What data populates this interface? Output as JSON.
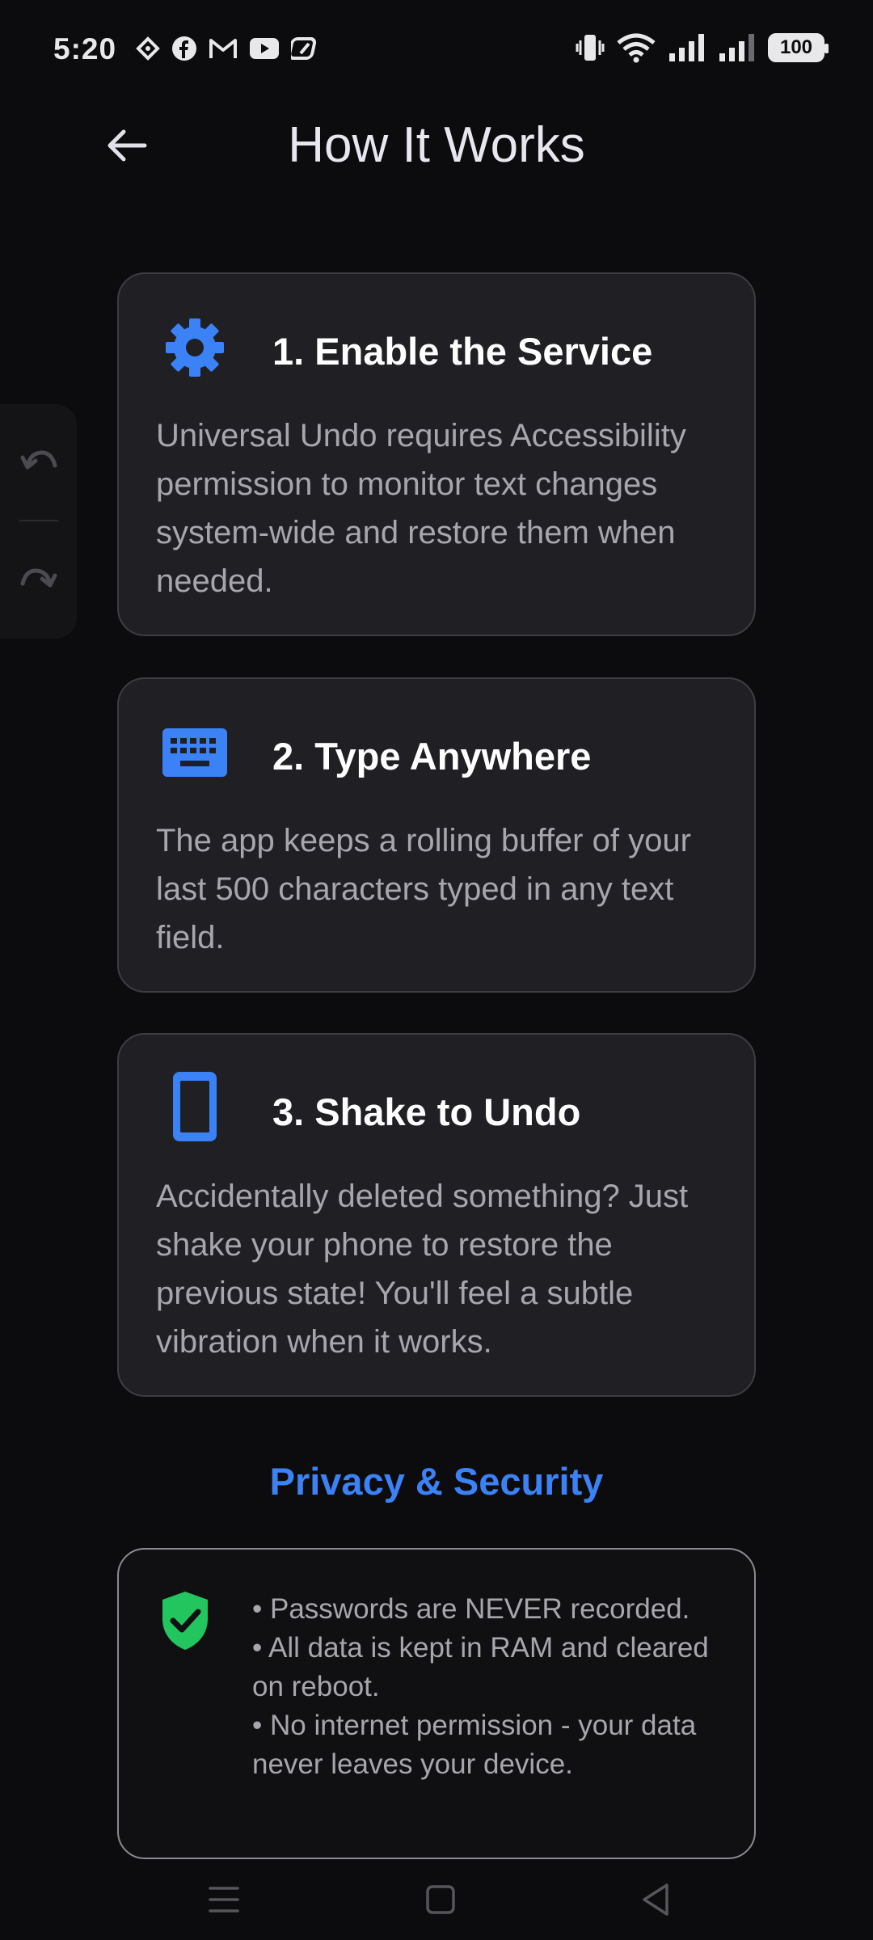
{
  "status_bar": {
    "time": "5:20",
    "battery": "100",
    "left_icons": [
      "diamond-icon",
      "facebook-icon",
      "gmail-icon",
      "youtube-icon",
      "app-icon"
    ],
    "right_icons": [
      "vibrate-icon",
      "wifi-icon",
      "signal-icon",
      "signal-icon"
    ]
  },
  "app_bar": {
    "title": "How It Works",
    "back_icon": "arrow-back-icon"
  },
  "floating_panel": {
    "undo_icon": "undo-icon",
    "redo_icon": "redo-icon"
  },
  "steps": [
    {
      "title": "1. Enable the Service",
      "body": "Universal Undo requires Accessibility permission to monitor text changes system-wide and restore them when needed.",
      "icon": "gear-icon"
    },
    {
      "title": "2. Type Anywhere",
      "body": "The app keeps a rolling buffer of your last 500 characters typed in any text field.",
      "icon": "keyboard-icon"
    },
    {
      "title": "3. Shake to Undo",
      "body": "Accidentally deleted something? Just shake your phone to restore the previous state! You'll feel a subtle vibration when it works.",
      "icon": "phone-icon"
    }
  ],
  "privacy": {
    "heading": "Privacy & Security",
    "icon": "shield-check-icon",
    "items": [
      "• Passwords are NEVER recorded.",
      "• All data is kept in RAM and cleared on reboot.",
      "• No internet permission - your data never leaves your device."
    ]
  },
  "colors": {
    "accent": "#3b82f6",
    "shield": "#22c55e",
    "card_bg": "#1f1f24",
    "background": "#0c0c0e"
  },
  "nav_bar": {
    "icons": [
      "menu-icon",
      "home-icon",
      "back-icon"
    ]
  }
}
